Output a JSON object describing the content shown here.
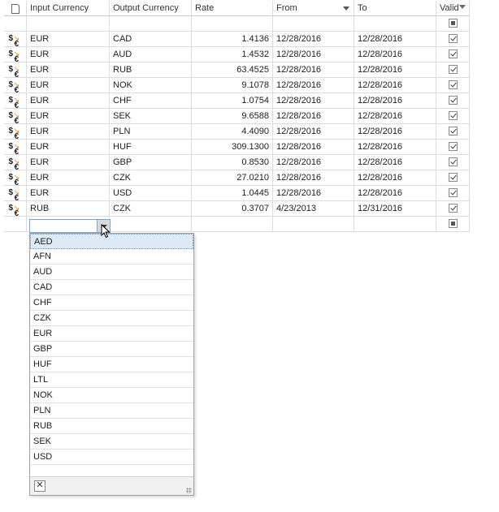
{
  "columns": {
    "icon": "",
    "input_currency": "Input Currency",
    "output_currency": "Output Currency",
    "rate": "Rate",
    "from": "From",
    "to": "To",
    "valid": "Valid"
  },
  "rows": [
    {
      "input": "EUR",
      "output": "CAD",
      "rate": "1.4136",
      "from": "12/28/2016",
      "to": "12/28/2016",
      "valid": true
    },
    {
      "input": "EUR",
      "output": "AUD",
      "rate": "1.4532",
      "from": "12/28/2016",
      "to": "12/28/2016",
      "valid": true
    },
    {
      "input": "EUR",
      "output": "RUB",
      "rate": "63.4525",
      "from": "12/28/2016",
      "to": "12/28/2016",
      "valid": true
    },
    {
      "input": "EUR",
      "output": "NOK",
      "rate": "9.1078",
      "from": "12/28/2016",
      "to": "12/28/2016",
      "valid": true
    },
    {
      "input": "EUR",
      "output": "CHF",
      "rate": "1.0754",
      "from": "12/28/2016",
      "to": "12/28/2016",
      "valid": true
    },
    {
      "input": "EUR",
      "output": "SEK",
      "rate": "9.6588",
      "from": "12/28/2016",
      "to": "12/28/2016",
      "valid": true
    },
    {
      "input": "EUR",
      "output": "PLN",
      "rate": "4.4090",
      "from": "12/28/2016",
      "to": "12/28/2016",
      "valid": true
    },
    {
      "input": "EUR",
      "output": "HUF",
      "rate": "309.1300",
      "from": "12/28/2016",
      "to": "12/28/2016",
      "valid": true
    },
    {
      "input": "EUR",
      "output": "GBP",
      "rate": "0.8530",
      "from": "12/28/2016",
      "to": "12/28/2016",
      "valid": true
    },
    {
      "input": "EUR",
      "output": "CZK",
      "rate": "27.0210",
      "from": "12/28/2016",
      "to": "12/28/2016",
      "valid": true
    },
    {
      "input": "EUR",
      "output": "USD",
      "rate": "1.0445",
      "from": "12/28/2016",
      "to": "12/28/2016",
      "valid": true
    },
    {
      "input": "RUB",
      "output": "CZK",
      "rate": "0.3707",
      "from": "4/23/2013",
      "to": "12/31/2016",
      "valid": true
    }
  ],
  "row_icon": "currency-exchange-icon",
  "dropdown": {
    "items": [
      "AED",
      "AFN",
      "AUD",
      "CAD",
      "CHF",
      "CZK",
      "EUR",
      "GBP",
      "HUF",
      "LTL",
      "NOK",
      "PLN",
      "RUB",
      "SEK",
      "USD"
    ],
    "selected": "AED"
  },
  "colors": {
    "grid_line": "#dcdcdc",
    "selection": "#dde9f6",
    "accent_arrow": "#e07818"
  }
}
